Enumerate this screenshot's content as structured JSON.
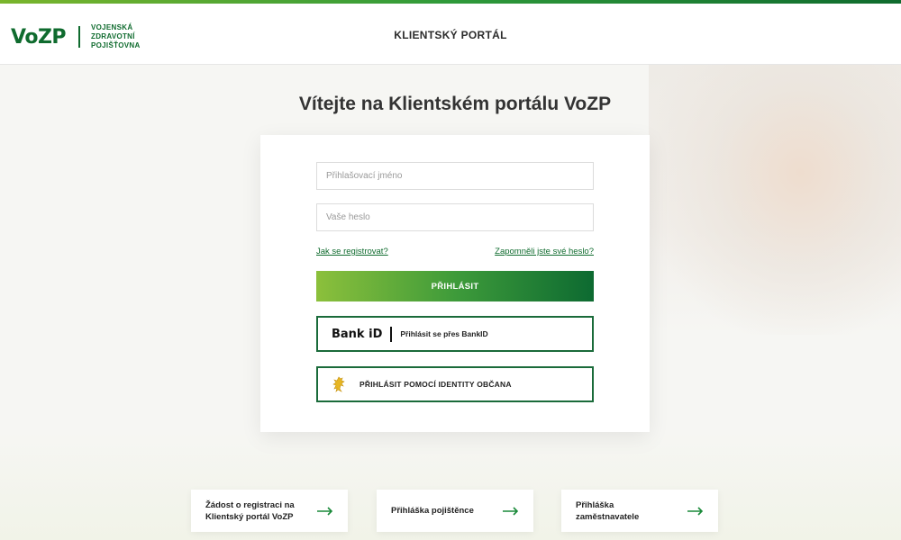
{
  "header": {
    "logo_mark": "VoZP",
    "logo_text_line1": "VOJENSKÁ",
    "logo_text_line2": "ZDRAVOTNÍ",
    "logo_text_line3": "POJIŠŤOVNA",
    "portal_title": "KLIENTSKÝ PORTÁL"
  },
  "main": {
    "welcome_title": "Vítejte na Klientském portálu VoZP"
  },
  "login": {
    "username_placeholder": "Přihlašovací jméno",
    "username_value": "",
    "password_placeholder": "Vaše heslo",
    "password_value": "",
    "register_link": "Jak se registrovat?",
    "forgot_link": "Zapomněli jste své heslo?",
    "login_button": "PŘIHLÁSIT",
    "bankid_logo": "Bank iD",
    "bankid_label": "Přihlásit se přes BankID",
    "identity_label": "PŘIHLÁSIT POMOCÍ IDENTITY OBČANA"
  },
  "tiles": [
    {
      "line1": "Žádost o registraci na",
      "line2": "Klientský portál VoZP",
      "icon": "arrow-right-icon"
    },
    {
      "line1": "Přihláška pojištěnce",
      "line2": "",
      "icon": "arrow-right-icon"
    },
    {
      "line1": "Přihláška",
      "line2": "zaměstnavatele",
      "icon": "arrow-right-icon"
    }
  ],
  "colors": {
    "brand_green": "#0f6b2e",
    "accent_lime": "#8cc03b",
    "identity_lion": "#e7b622"
  }
}
